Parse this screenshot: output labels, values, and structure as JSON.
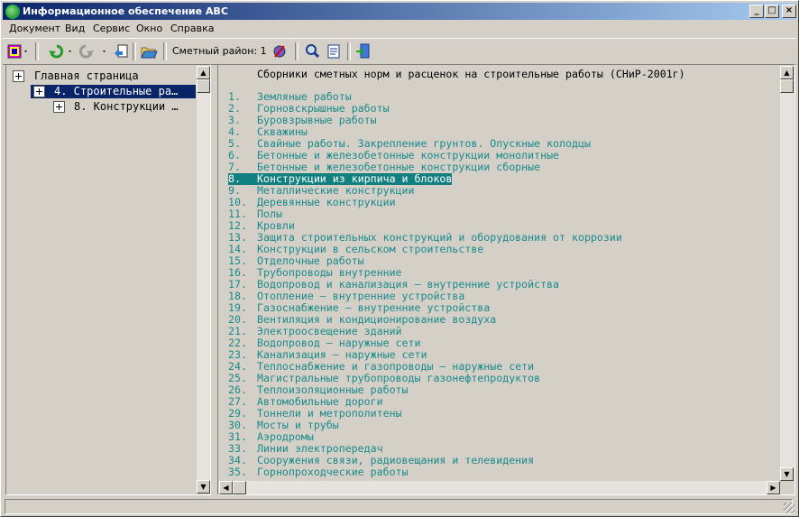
{
  "window": {
    "title": "Информационное обеспечение АВС"
  },
  "menu": [
    "Документ",
    "Вид",
    "Сервис",
    "Окно",
    "Справка"
  ],
  "toolbar": {
    "region_label": "Сметный район: 1"
  },
  "tree": {
    "items": [
      {
        "label": "Главная страница"
      },
      {
        "label": "4. Строительные ра…"
      },
      {
        "label": "8. Конструкции …"
      }
    ]
  },
  "content": {
    "heading": "Сборники сметных норм и расценок на строительные работы (СНиР-2001г)",
    "selected_index": 7,
    "rows": [
      {
        "num": "1.",
        "text": "Земляные работы"
      },
      {
        "num": "2.",
        "text": "Горновскрышные работы"
      },
      {
        "num": "3.",
        "text": "Буровзрывные работы"
      },
      {
        "num": "4.",
        "text": "Скважины"
      },
      {
        "num": "5.",
        "text": "Свайные работы. Закрепление грунтов. Опускные колодцы"
      },
      {
        "num": "6.",
        "text": "Бетонные и железобетонные конструкции монолитные"
      },
      {
        "num": "7.",
        "text": "Бетонные и железобетонные конструкции сборные"
      },
      {
        "num": "8.",
        "text": "Конструкции из кирпича и блоков"
      },
      {
        "num": "9.",
        "text": "Металлические конструкции"
      },
      {
        "num": "10.",
        "text": "Деревянные конструкции"
      },
      {
        "num": "11.",
        "text": "Полы"
      },
      {
        "num": "12.",
        "text": "Кровли"
      },
      {
        "num": "13.",
        "text": "Защита строительных конструкций и оборудования от коррозии"
      },
      {
        "num": "14.",
        "text": "Конструкции в сельском строительстве"
      },
      {
        "num": "15.",
        "text": "Отделочные работы"
      },
      {
        "num": "16.",
        "text": "Трубопроводы внутренние"
      },
      {
        "num": "17.",
        "text": "Водопровод и канализация – внутренние устройства"
      },
      {
        "num": "18.",
        "text": "Отопление – внутренние устройства"
      },
      {
        "num": "19.",
        "text": "Газоснабжение – внутренние устройства"
      },
      {
        "num": "20.",
        "text": "Вентиляция и кондиционирование воздуха"
      },
      {
        "num": "21.",
        "text": "Электроосвещение зданий"
      },
      {
        "num": "22.",
        "text": "Водопровод – наружные сети"
      },
      {
        "num": "23.",
        "text": "Канализация – наружные сети"
      },
      {
        "num": "24.",
        "text": "Теплоснабжение и газопроводы – наружные сети"
      },
      {
        "num": "25.",
        "text": "Магистральные трубопроводы газонефтепродуктов"
      },
      {
        "num": "26.",
        "text": "Теплоизоляционные работы"
      },
      {
        "num": "27.",
        "text": "Автомобильные дороги"
      },
      {
        "num": "29.",
        "text": "Тоннели и метрополитены"
      },
      {
        "num": "30.",
        "text": "Мосты и трубы"
      },
      {
        "num": "31.",
        "text": "Аэродромы"
      },
      {
        "num": "33.",
        "text": "Линии электропередач"
      },
      {
        "num": "34.",
        "text": "Сооружения связи, радиовещания и телевидения"
      },
      {
        "num": "35.",
        "text": "Горнопроходческие работы"
      }
    ]
  },
  "colors": {
    "link_text": "#1a8a8a",
    "selection": "#138080",
    "titlebar_start": "#0a246a",
    "titlebar_end": "#a6caf0"
  }
}
